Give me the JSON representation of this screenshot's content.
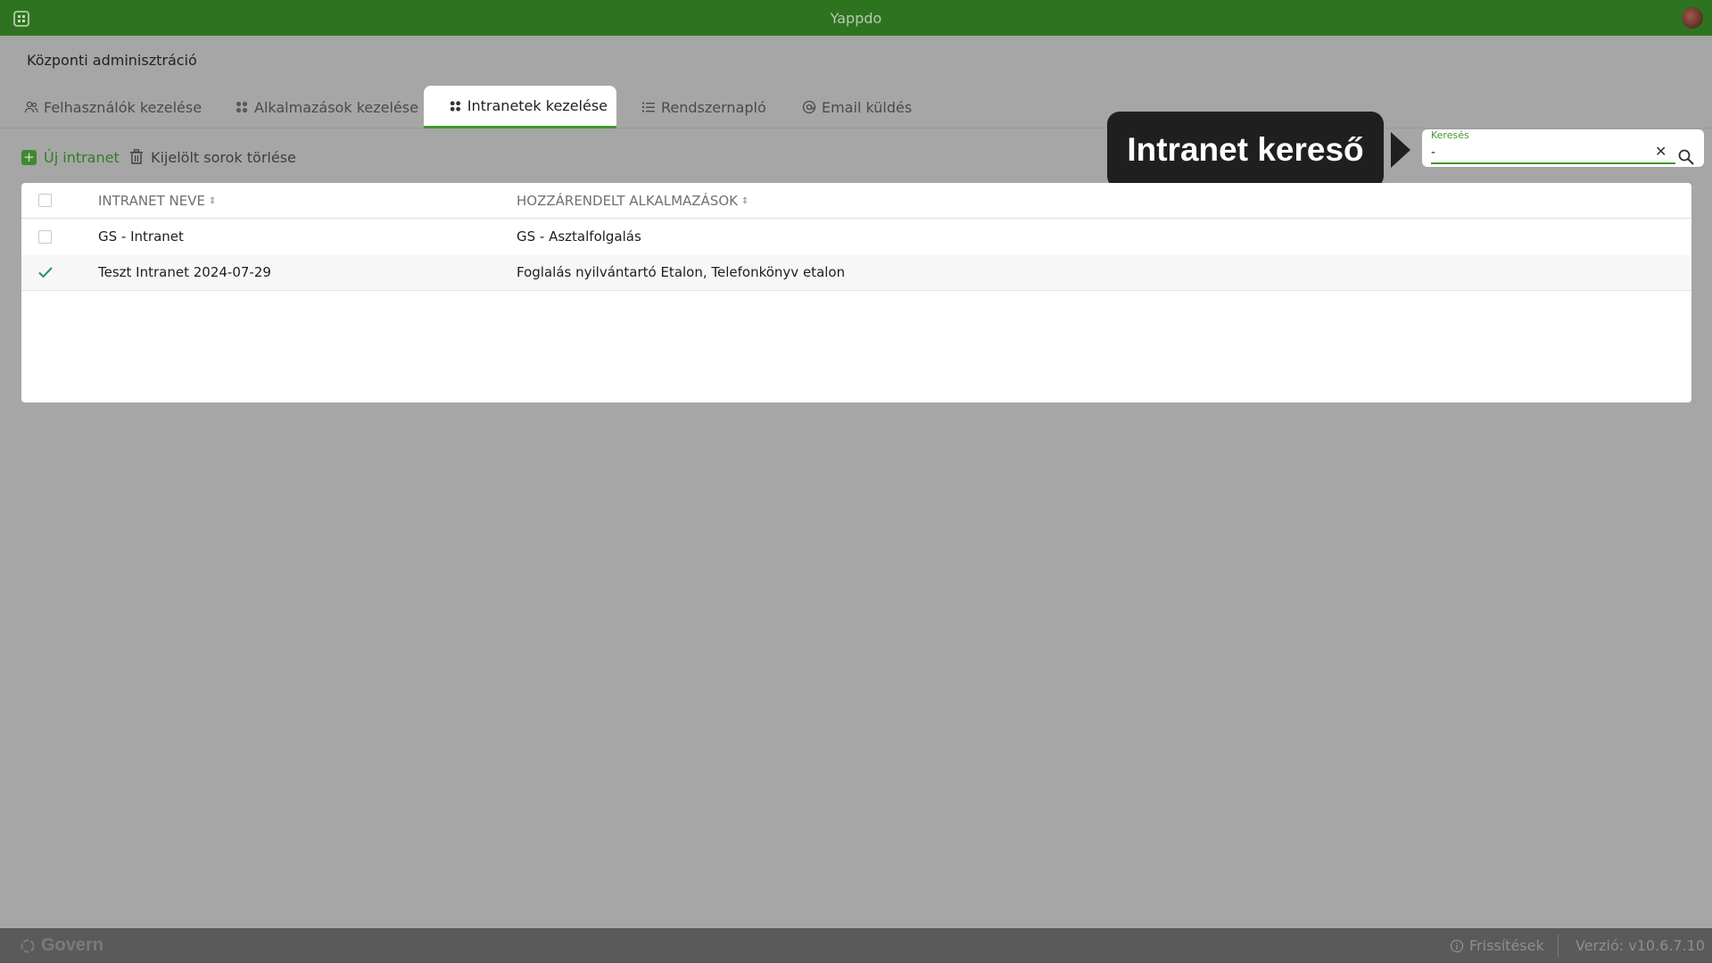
{
  "app": {
    "title": "Yappdo"
  },
  "page": {
    "title": "Központi adminisztráció"
  },
  "tabs": [
    {
      "label": "Felhasználók kezelése",
      "icon": "users-icon"
    },
    {
      "label": "Alkalmazások kezelése",
      "icon": "apps-grid-icon"
    },
    {
      "label": "Intranetek kezelése",
      "icon": "apps-grid-icon",
      "active": true
    },
    {
      "label": "Rendszernapló",
      "icon": "list-icon"
    },
    {
      "label": "Email küldés",
      "icon": "at-icon"
    }
  ],
  "toolbar": {
    "new_label": "Új intranet",
    "delete_label": "Kijelölt sorok törlése"
  },
  "tooltip": {
    "text": "Intranet kereső"
  },
  "search": {
    "label": "Keresés",
    "value": "-"
  },
  "table": {
    "columns": [
      "INTRANET NEVE",
      "HOZZÁRENDELT ALKALMAZÁSOK"
    ],
    "rows": [
      {
        "name": "GS - Intranet",
        "apps": "GS - Asztalfolgalás",
        "selected": false
      },
      {
        "name": "Teszt Intranet 2024-07-29",
        "apps": "Foglalás nyilvántartó Etalon, Telefonkönyv etalon",
        "selected": true
      }
    ]
  },
  "footer": {
    "brand": "Govern",
    "updates_label": "Frissítések",
    "version": "Verzió: v10.6.7.10"
  },
  "colors": {
    "topbar": "#2e7420",
    "accent": "#3d9a2b",
    "overlay_bg": "#a6a6a6",
    "footer": "#5a5a5a"
  }
}
